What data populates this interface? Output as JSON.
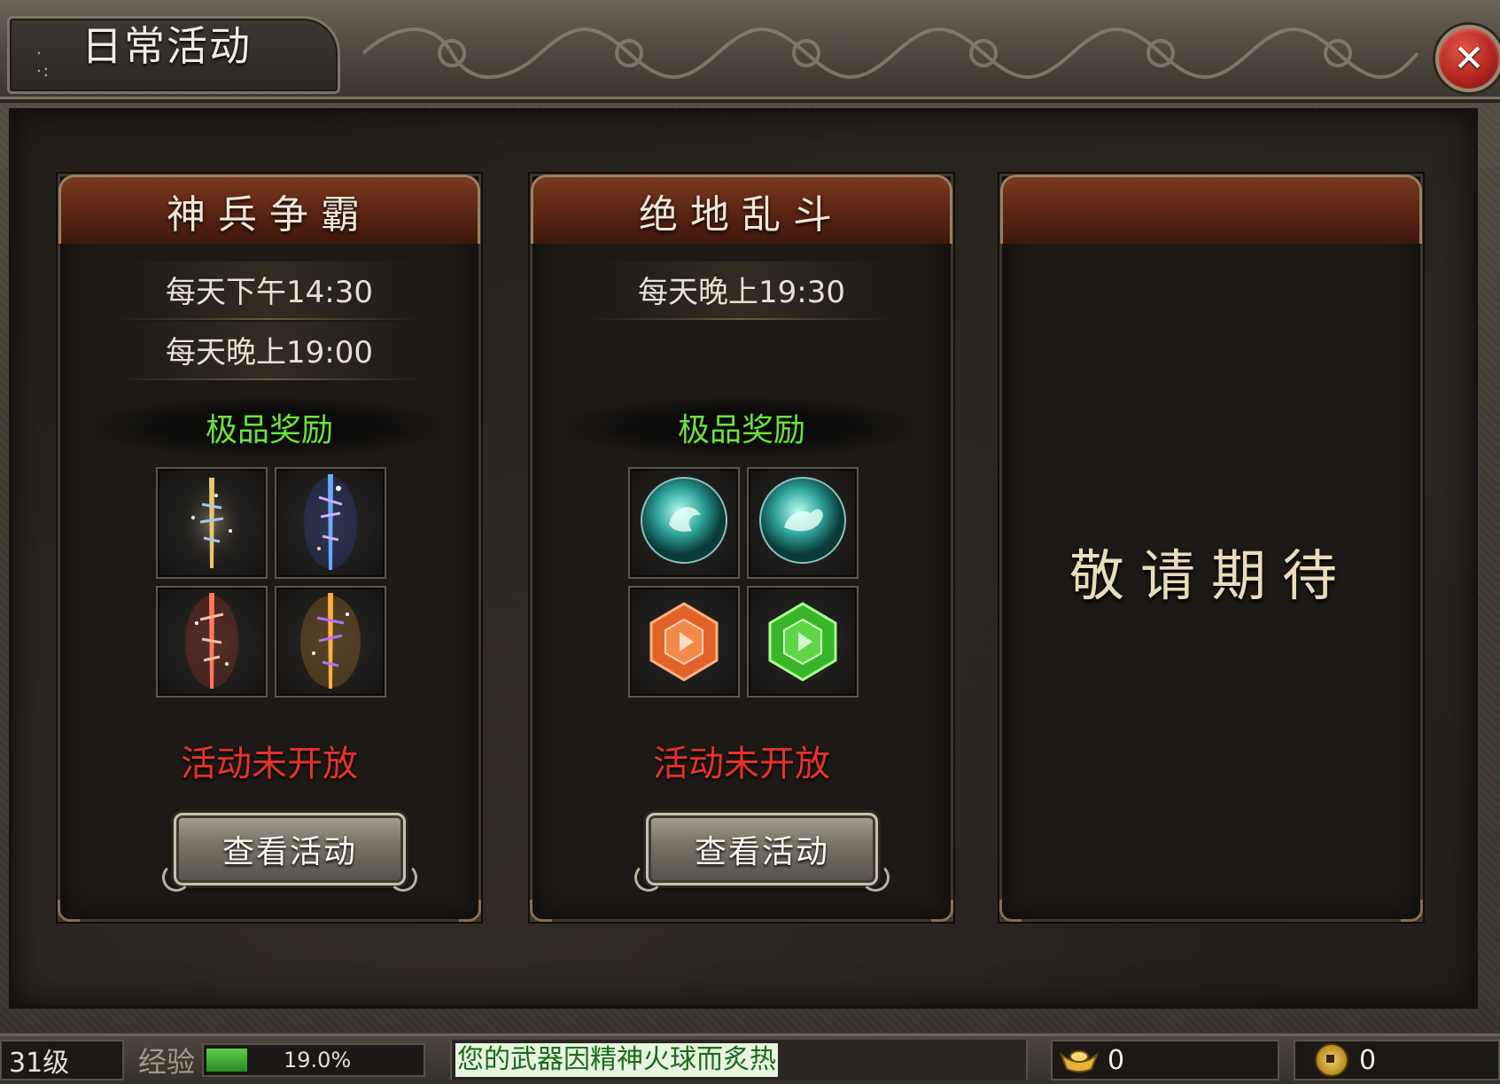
{
  "window": {
    "title": "日常活动",
    "close_icon": "close-icon"
  },
  "panels": [
    {
      "title": "神兵争霸",
      "times": [
        "每天下午14:30",
        "每天晚上19:00"
      ],
      "reward_title": "极品奖励",
      "rewards": [
        "gold-sword-icon",
        "blue-sword-icon",
        "red-sword-icon",
        "orange-sword-icon"
      ],
      "status": "活动未开放",
      "button": "查看活动"
    },
    {
      "title": "绝地乱斗",
      "times": [
        "每天晚上19:30"
      ],
      "reward_title": "极品奖励",
      "rewards": [
        "rooster-orb-icon",
        "dog-orb-icon",
        "orange-gem-icon",
        "green-gem-icon"
      ],
      "status": "活动未开放",
      "button": "查看活动"
    },
    {
      "title": "",
      "coming_soon": "敬请期待"
    }
  ],
  "statusbar": {
    "level": "31级",
    "exp_label": "经验",
    "exp_percent": "19.0%",
    "exp_fraction": 0.19,
    "message": "您的武器因精神火球而炙热",
    "gold": "0",
    "coins": "0"
  },
  "colors": {
    "reward_title": "#6be23d",
    "status_closed": "#e6332a",
    "header_red": "#5a2412"
  }
}
